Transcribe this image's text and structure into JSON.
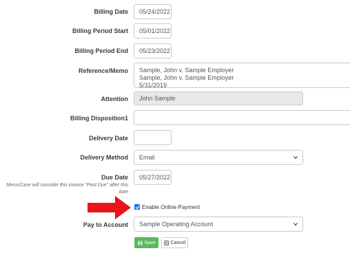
{
  "form": {
    "billing_date": {
      "label": "Billing Date",
      "value": "05/24/2022"
    },
    "billing_period_start": {
      "label": "Billing Period Start",
      "value": "05/01/2022"
    },
    "billing_period_end": {
      "label": "Billing Period End",
      "value": "05/23/2022"
    },
    "reference_memo": {
      "label": "Reference/Memo",
      "lines": [
        "Sample, John v. Sample Employer",
        "Sample, John v. Sample Employer",
        "5/31/2019"
      ]
    },
    "attention": {
      "label": "Attention",
      "value": "John Sample"
    },
    "billing_disposition": {
      "label": "Billing Disposition1",
      "value": ""
    },
    "delivery_date": {
      "label": "Delivery Date",
      "value": ""
    },
    "delivery_method": {
      "label": "Delivery Method",
      "value": "Email"
    },
    "due_date": {
      "label": "Due Date",
      "value": "05/27/2022",
      "hint": "MerusCase will consider this invoice \"Past Due\" after this date"
    },
    "enable_online_payment": {
      "label": "Enable Online Payment",
      "checked": true
    },
    "pay_to_account": {
      "label": "Pay to Account",
      "value": "Sample Operating Account"
    }
  },
  "buttons": {
    "save": "Save",
    "cancel": "Cancel"
  },
  "colors": {
    "arrow": "#e8151b",
    "save": "#5cb85c",
    "checkbox": "#1a73e8"
  }
}
